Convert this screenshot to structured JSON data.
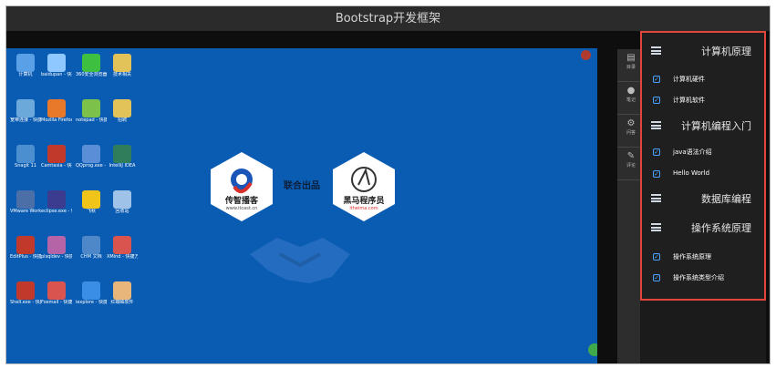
{
  "window": {
    "title": "Bootstrap开发框架"
  },
  "logos": {
    "left": {
      "name": "传智播客",
      "url": "www.itcast.cn"
    },
    "joint": "联合出品",
    "right": {
      "name": "黑马程序员",
      "url": "itheima.com"
    }
  },
  "side_strip": [
    {
      "label": "目录",
      "icon": "list-icon"
    },
    {
      "label": "笔记",
      "icon": "person-icon"
    },
    {
      "label": "问答",
      "icon": "gear-icon"
    },
    {
      "label": "评论",
      "icon": "comment-icon"
    }
  ],
  "panel": {
    "groups": [
      {
        "title": "计算机原理",
        "items": [
          "计算机硬件",
          "计算机软件"
        ]
      },
      {
        "title": "计算机编程入门",
        "items": [
          "java语法介绍",
          "Hello World"
        ]
      },
      {
        "title": "数据库编程",
        "items": []
      },
      {
        "title": "操作系统原理",
        "items": [
          "操作系统原理",
          "操作系统类型介绍"
        ]
      }
    ]
  },
  "desktop_icons": [
    {
      "label": "计算机",
      "color": "#5aa0e6"
    },
    {
      "label": "baidupan - 快捷方式",
      "color": "#8fc7ff"
    },
    {
      "label": "360安全浏览器",
      "color": "#3fbf3f"
    },
    {
      "label": "技术相关",
      "color": "#e2c35a"
    },
    {
      "label": "宽带连接 - 快捷方式",
      "color": "#6aa9d9"
    },
    {
      "label": "Mozilla Firefox",
      "color": "#e8792b"
    },
    {
      "label": "notepad - 快捷方式",
      "color": "#7cc24a"
    },
    {
      "label": "招聘",
      "color": "#e2c35a"
    },
    {
      "label": "Snagit 11",
      "color": "#4b8fd1"
    },
    {
      "label": "Camtasia - 快捷方式",
      "color": "#c0392b"
    },
    {
      "label": "QQprog.exe - 快捷方式",
      "color": "#5a8fd8"
    },
    {
      "label": "IntelliJ IDEA",
      "color": "#2f7d5a"
    },
    {
      "label": "VMware Workstation",
      "color": "#4c6fa8"
    },
    {
      "label": "eclipse.exe - 快捷方式",
      "color": "#3b3b8f"
    },
    {
      "label": "飞秋",
      "color": "#f0c419"
    },
    {
      "label": "回收站",
      "color": "#9fc3e8"
    },
    {
      "label": "EditPlus - 快捷方式",
      "color": "#c0392b"
    },
    {
      "label": "plsqldev - 快捷方式",
      "color": "#b565a7"
    },
    {
      "label": "CHM 文档",
      "color": "#4f88c9"
    },
    {
      "label": "XMind - 快捷方式",
      "color": "#d9534f"
    },
    {
      "label": "Shell.exe - 快捷方式",
      "color": "#c0392b"
    },
    {
      "label": "Foxmail - 快捷方式",
      "color": "#d9534f"
    },
    {
      "label": "iexplore - 快捷方式",
      "color": "#3a8ee6"
    },
    {
      "label": "红蜘蛛软件",
      "color": "#e8b67a"
    }
  ],
  "colors": {
    "desktop": "#0a5cb3",
    "panel_border": "#e2453c",
    "check": "#4aa3ff"
  }
}
